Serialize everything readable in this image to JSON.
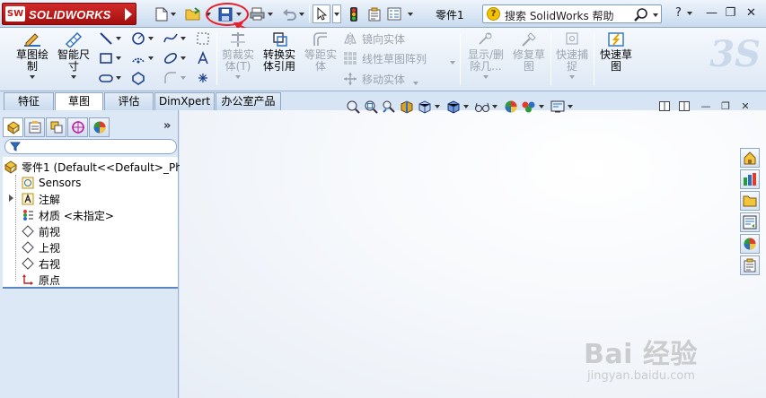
{
  "app": {
    "brand": "SOLIDWORKS",
    "brand_mark": "SW",
    "document_title": "零件1"
  },
  "search": {
    "text": "搜索 SolidWorks 帮助",
    "help_glyph": "?"
  },
  "window_controls": {
    "help": "?",
    "minimize": "—",
    "restore": "❐",
    "close": "✕"
  },
  "ribbon": {
    "sketch": "草图绘\n制",
    "smart_dimension": "智能尺\n寸",
    "trim": "剪裁实\n体(T)",
    "convert": "转换实\n体引用",
    "offset": "等距实\n体",
    "mirror": "镜向实体",
    "linear_pattern": "线性草图阵列",
    "move": "移动实体",
    "display_delete": "显示/删\n除几...",
    "repair": "修复草\n图",
    "quick_snaps": "快速捕\n捉",
    "rapid_sketch": "快速草\n图"
  },
  "tabs": [
    "特征",
    "草图",
    "评估",
    "DimXpert",
    "办公室产品"
  ],
  "active_tab": "草图",
  "tree": {
    "root": "零件1  (Default<<Default>_Ph",
    "items": [
      {
        "label": "Sensors"
      },
      {
        "label": "注解"
      },
      {
        "label": "材质 <未指定>"
      },
      {
        "label": "前视"
      },
      {
        "label": "上视"
      },
      {
        "label": "右视"
      },
      {
        "label": "原点"
      }
    ]
  },
  "panel": {
    "more": "»"
  },
  "watermark": {
    "brand": "Bai 经验",
    "url": "jingyan.baidu.com",
    "logo_text": "3S"
  },
  "colors": {
    "accent_red": "#e8202a",
    "brand_red": "#c41a1a",
    "tree_separator": "#5a86c2"
  }
}
